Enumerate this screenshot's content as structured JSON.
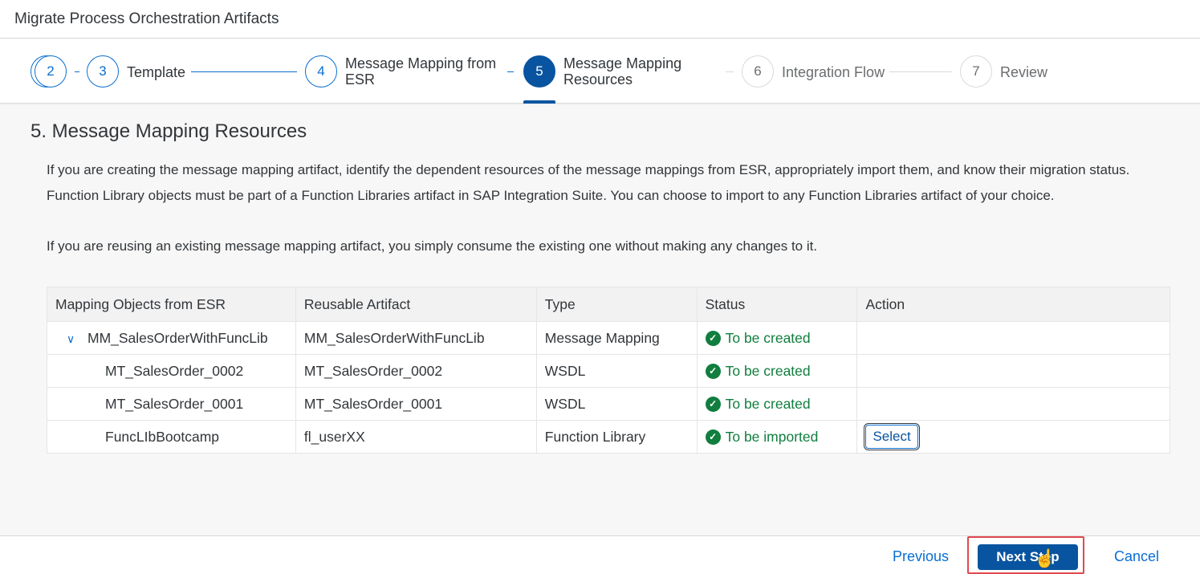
{
  "window": {
    "title": "Migrate Process Orchestration Artifacts"
  },
  "wizard": {
    "steps": [
      {
        "number": "2",
        "label": ""
      },
      {
        "number": "3",
        "label": "Template"
      },
      {
        "number": "4",
        "label": "Message Mapping from ESR"
      },
      {
        "number": "5",
        "label": "Message Mapping Resources"
      },
      {
        "number": "6",
        "label": "Integration Flow"
      },
      {
        "number": "7",
        "label": "Review"
      }
    ],
    "active_step": "5"
  },
  "main": {
    "section_title": "5. Message Mapping Resources",
    "paragraph1_line1": "If you are creating the message mapping artifact, identify the dependent resources of the message mappings from ESR, appropriately import them, and know their migration status.",
    "paragraph1_line2": "Function Library objects must be part of a Function Libraries artifact in SAP Integration Suite. You can choose to import to any Function Libraries artifact of your choice.",
    "paragraph2": "If you are reusing an existing message mapping artifact, you simply consume the existing one without making any changes to it."
  },
  "table": {
    "columns": [
      "Mapping Objects from ESR",
      "Reusable Artifact",
      "Type",
      "Status",
      "Action"
    ],
    "rows": [
      {
        "object": "MM_SalesOrderWithFuncLib",
        "artifact": "MM_SalesOrderWithFuncLib",
        "type": "Message Mapping",
        "status": "To be created",
        "action": ""
      },
      {
        "object": "MT_SalesOrder_0002",
        "artifact": "MT_SalesOrder_0002",
        "type": "WSDL",
        "status": "To be created",
        "action": ""
      },
      {
        "object": "MT_SalesOrder_0001",
        "artifact": "MT_SalesOrder_0001",
        "type": "WSDL",
        "status": "To be created",
        "action": ""
      },
      {
        "object": "FuncLIbBootcamp",
        "artifact": "fl_userXX",
        "type": "Function Library",
        "status": "To be imported",
        "action": "Select"
      }
    ],
    "status_color": "#107e3e"
  },
  "footer": {
    "previous": "Previous",
    "next": "Next Step",
    "cancel": "Cancel"
  },
  "colors": {
    "accent": "#0854a0",
    "link": "#0a6ed1",
    "highlight": "#e0494f"
  }
}
